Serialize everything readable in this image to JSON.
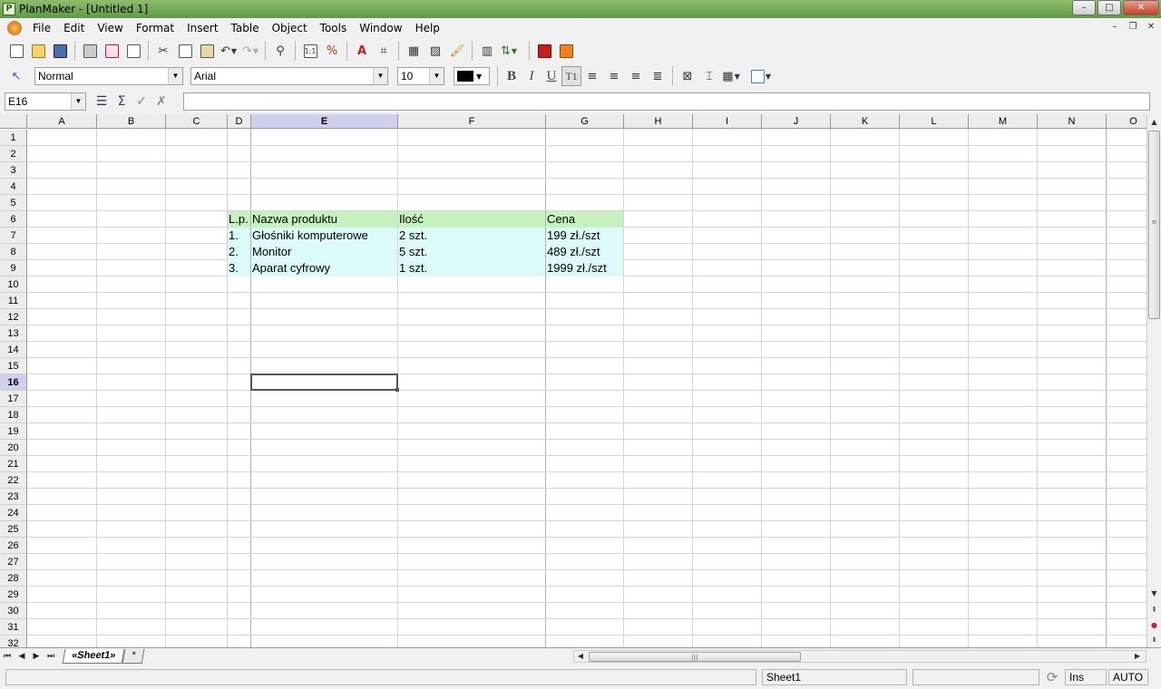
{
  "window": {
    "title": "PlanMaker - [Untitled 1]",
    "app_icon_letter": "P",
    "minimize": "–",
    "maximize": "□",
    "close": "✕"
  },
  "menubar": {
    "items": [
      "File",
      "Edit",
      "View",
      "Format",
      "Insert",
      "Table",
      "Object",
      "Tools",
      "Window",
      "Help"
    ]
  },
  "toolbar_standard": {
    "icons": [
      "new-icon",
      "open-icon",
      "save-icon",
      "print-icon",
      "pdf-export-icon",
      "print-preview-icon",
      "cut-icon",
      "copy-icon",
      "paste-icon",
      "undo-icon",
      "redo-icon",
      "find-icon",
      "number-format-icon",
      "percent-icon",
      "insert-text-icon",
      "insert-frame-icon",
      "cell-borders-icon",
      "cell-shading-icon",
      "format-painter-icon",
      "autofilter-icon",
      "sort-icon",
      "textmaker-icon",
      "presentations-icon"
    ]
  },
  "toolbar_format": {
    "style": "Normal",
    "font": "Arial",
    "size": "10",
    "text_color": "#000000",
    "bold": "B",
    "italic": "I",
    "underline": "U",
    "text_t": "T1"
  },
  "formula_bar": {
    "cell_ref": "E16",
    "content": ""
  },
  "grid": {
    "columns": [
      "A",
      "B",
      "C",
      "D",
      "E",
      "F",
      "G",
      "H",
      "I",
      "J",
      "K",
      "L",
      "M",
      "N",
      "O"
    ],
    "selected_column": "E",
    "rows": [
      "1",
      "2",
      "3",
      "4",
      "5",
      "6",
      "7",
      "8",
      "9",
      "10",
      "11",
      "12",
      "13",
      "14",
      "15",
      "16",
      "17",
      "18",
      "19",
      "20",
      "21",
      "22",
      "23",
      "24",
      "25",
      "26",
      "27",
      "28",
      "29",
      "30",
      "31",
      "32"
    ],
    "selected_row": "16",
    "header_fill": "#c6f2c0",
    "data_fill": "#dcfafa",
    "table": {
      "header": [
        "L.p.",
        "Nazwa produktu",
        "Ilość",
        "Cena"
      ],
      "rows": [
        [
          "1.",
          "Głośniki komputerowe",
          "2 szt.",
          "199 zł./szt"
        ],
        [
          "2.",
          "Monitor",
          "5 szt.",
          "489 zł./szt"
        ],
        [
          "3.",
          "Aparat cyfrowy",
          "1 szt.",
          "1999 zł./szt"
        ]
      ]
    }
  },
  "sheet_tabs": {
    "active": "«Sheet1»",
    "new": "*"
  },
  "statusbar": {
    "sheet": "Sheet1",
    "ins": "Ins",
    "auto": "AUTO"
  }
}
